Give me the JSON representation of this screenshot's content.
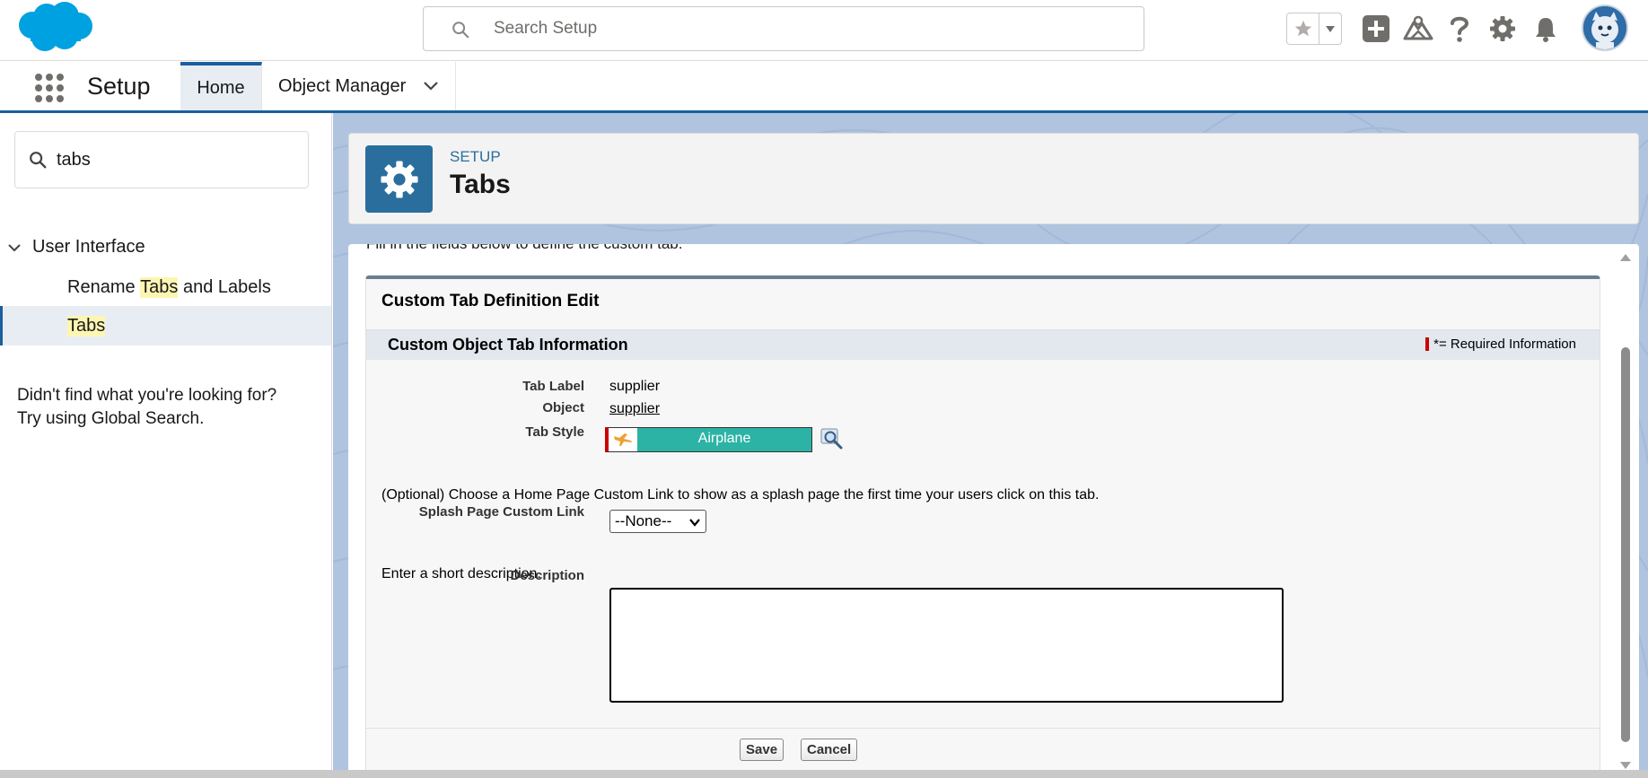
{
  "header": {
    "search_placeholder": "Search Setup",
    "brand_color": "#00a1e0"
  },
  "context_bar": {
    "app_name": "Setup",
    "tabs": [
      {
        "label": "Home",
        "active": true
      },
      {
        "label": "Object Manager",
        "active": false
      }
    ]
  },
  "sidebar": {
    "quick_find_value": "tabs",
    "group_label": "User Interface",
    "items": [
      {
        "prefix": "Rename ",
        "highlight": "Tabs",
        "suffix": " and Labels",
        "selected": false
      },
      {
        "prefix": "",
        "highlight": "Tabs",
        "suffix": "",
        "selected": true
      }
    ],
    "not_found_line1": "Didn't find what you're looking for?",
    "not_found_line2": "Try using Global Search."
  },
  "page_header": {
    "eyebrow": "SETUP",
    "title": "Tabs"
  },
  "form": {
    "intro": "Fill in the fields below to define the custom tab.",
    "panel_title": "Custom Tab Definition Edit",
    "section_title": "Custom Object Tab Information",
    "required_note": "*= Required Information",
    "fields": {
      "tab_label": {
        "label": "Tab Label",
        "value": "supplier"
      },
      "object": {
        "label": "Object",
        "value": "supplier"
      },
      "tab_style": {
        "label": "Tab Style",
        "value": "Airplane",
        "color": "#2db3a5"
      },
      "splash_intro": "(Optional) Choose a Home Page Custom Link to show as a splash page the first time your users click on this tab.",
      "splash": {
        "label": "Splash Page Custom Link",
        "value": "--None--"
      },
      "desc_intro": "Enter a short description.",
      "description": {
        "label": "Description",
        "value": ""
      }
    },
    "buttons": {
      "save": "Save",
      "cancel": "Cancel"
    }
  }
}
